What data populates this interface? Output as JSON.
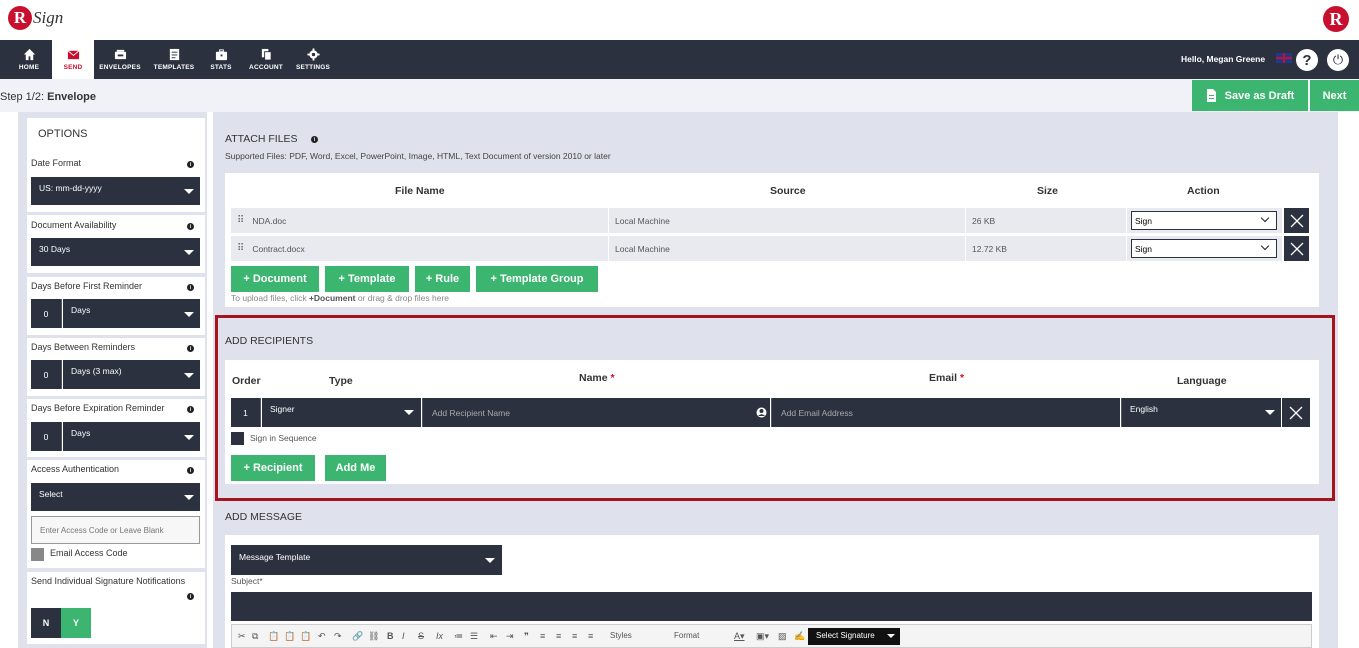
{
  "brand": {
    "logo_letter": "R",
    "logo_text": "Sign",
    "accent": "#c8102e",
    "nav_bg": "#2c3140",
    "green": "#3bb56f"
  },
  "nav": {
    "items": [
      {
        "label": "HOME",
        "icon": "home-icon"
      },
      {
        "label": "SEND",
        "icon": "envelope-icon",
        "active": true
      },
      {
        "label": "ENVELOPES",
        "icon": "inbox-icon"
      },
      {
        "label": "TEMPLATES",
        "icon": "template-icon"
      },
      {
        "label": "STATS",
        "icon": "briefcase-icon"
      },
      {
        "label": "ACCOUNT",
        "icon": "account-icon"
      },
      {
        "label": "SETTINGS",
        "icon": "gear-icon"
      }
    ],
    "greeting": "Hello, Megan Greene",
    "help": "?",
    "power": "⏻"
  },
  "step": {
    "prefix": "Step 1/2:",
    "name": "Envelope"
  },
  "actions": {
    "save_draft": "Save as Draft",
    "next": "Next"
  },
  "options": {
    "title": "OPTIONS",
    "date_format": {
      "label": "Date Format",
      "value": "US: mm-dd-yyyy"
    },
    "doc_availability": {
      "label": "Document Availability",
      "value": "30 Days"
    },
    "first_reminder": {
      "label": "Days Before First Reminder",
      "num": "0",
      "unit": "Days"
    },
    "between_reminders": {
      "label": "Days Between Reminders",
      "num": "0",
      "unit": "Days (3 max)"
    },
    "expiration_reminder": {
      "label": "Days Before Expiration Reminder",
      "num": "0",
      "unit": "Days"
    },
    "access_auth": {
      "label": "Access Authentication",
      "value": "Select",
      "placeholder": "Enter Access Code or Leave Blank",
      "email_code": "Email Access Code"
    },
    "individual_notifications": {
      "label": "Send Individual Signature Notifications",
      "no": "N",
      "yes": "Y"
    }
  },
  "attach": {
    "title": "ATTACH FILES",
    "supported": "Supported Files: PDF, Word, Excel, PowerPoint, Image, HTML, Text Document of version 2010 or later",
    "headers": {
      "file": "File Name",
      "source": "Source",
      "size": "Size",
      "action": "Action"
    },
    "files": [
      {
        "name": "NDA.doc",
        "source": "Local Machine",
        "size": "26 KB",
        "action": "Sign"
      },
      {
        "name": "Contract.docx",
        "source": "Local Machine",
        "size": "12.72 KB",
        "action": "Sign"
      }
    ],
    "buttons": {
      "document": "+ Document",
      "template": "+ Template",
      "rule": "+ Rule",
      "template_group": "+ Template Group"
    },
    "hint_pre": "To upload files, click ",
    "hint_bold": "+Document",
    "hint_post": " or drag & drop files here"
  },
  "recipients": {
    "title": "ADD RECIPIENTS",
    "headers": {
      "order": "Order",
      "type": "Type",
      "name": "Name",
      "email": "Email",
      "language": "Language",
      "required": "*"
    },
    "row": {
      "order": "1",
      "type": "Signer",
      "name_placeholder": "Add Recipient Name",
      "email_placeholder": "Add Email Address",
      "language": "English"
    },
    "sequence": "Sign in Sequence",
    "add_recipient": "+ Recipient",
    "add_me": "Add Me"
  },
  "message": {
    "title": "ADD MESSAGE",
    "template": "Message Template",
    "subject_label": "Subject*",
    "toolbar": {
      "styles": "Styles",
      "format": "Format",
      "signature": "Select Signature"
    }
  }
}
